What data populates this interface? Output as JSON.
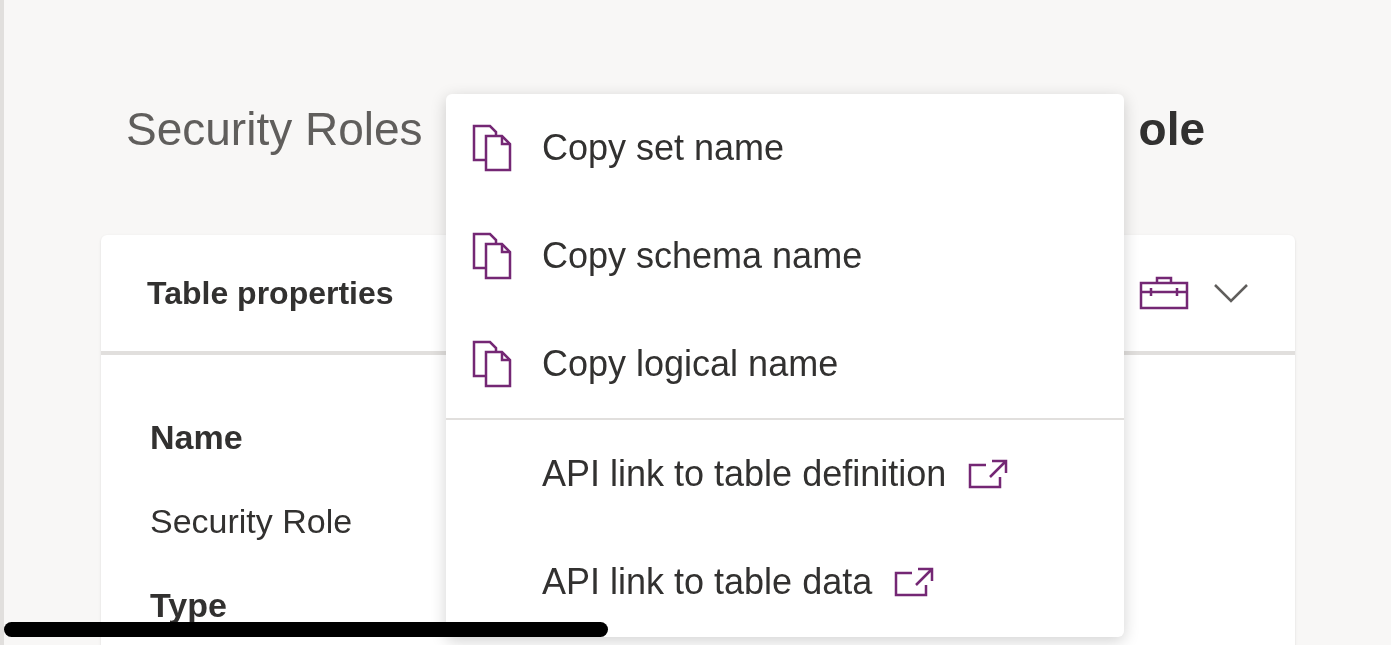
{
  "header": {
    "breadcrumb": "Security Roles",
    "title": "ole"
  },
  "card": {
    "title": "Table properties",
    "fields": [
      {
        "label": "Name",
        "value": "Security Role"
      },
      {
        "label": "Type"
      }
    ]
  },
  "menu": {
    "items": [
      {
        "kind": "copy",
        "label": "Copy set name"
      },
      {
        "kind": "copy",
        "label": "Copy schema name"
      },
      {
        "kind": "copy",
        "label": "Copy logical name"
      },
      {
        "kind": "link",
        "label": "API link to table definition"
      },
      {
        "kind": "link",
        "label": "API link to table data"
      }
    ]
  }
}
